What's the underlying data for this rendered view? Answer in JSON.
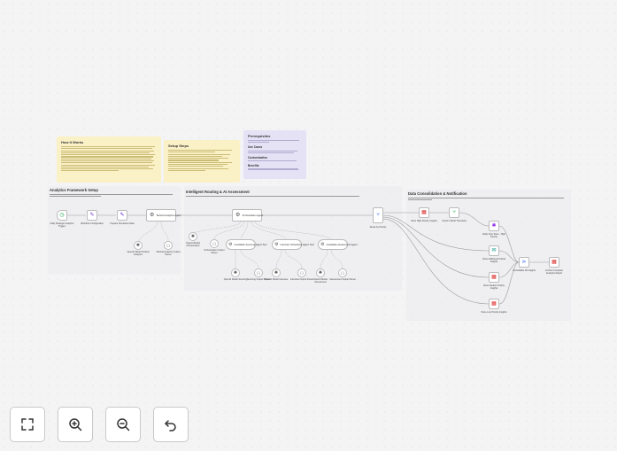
{
  "notes": {
    "how_it_works": {
      "title": "How It Works"
    },
    "setup_steps": {
      "title": "Setup Steps"
    },
    "prereq": {
      "title": "Prerequisites",
      "use_cases": "Use Cases",
      "customization": "Customization",
      "benefits": "Benefits"
    }
  },
  "sections": {
    "setup": {
      "title": "Analytics Framework Setup"
    },
    "routing": {
      "title": "Intelligent Routing & AI Assessment"
    },
    "consolidation": {
      "title": "Data Consolidation & Notification"
    }
  },
  "nodes": {
    "trigger": "Daily Strategic Analytics Trigger",
    "workflow_config": "Workflow Configuration",
    "prepare": "Prepare Simulation Data",
    "agent1": "Tactical Analytics Agent",
    "orchestration": "Orchestration Agent",
    "route": "Route by Priority",
    "high_priority": "Store High Priority Insights",
    "critical": "Check Critical Threshold",
    "slack": "Notify Ops Team - High Priority",
    "critical_insights": "Store Additional Critical Insights",
    "medium": "Store Medium Priority Insights",
    "low": "Store Low Priority Insights",
    "consolidate": "Consolidate All Insights",
    "archive": "Archive Complete Analytics Report",
    "openai_main": "OpenAI Model Tactical Analytics",
    "parser_main": "Tactical Analytics Output Parser",
    "tool1": "Candidate Sourcing Agent Tool",
    "tool2": "Interview Scheduling Agent Tool",
    "tool3": "Candidate Assessment Agent",
    "openai_orch": "OpenAI Model Orchestration",
    "parser_orch": "Orchestration Output Parser",
    "openai_t1": "OpenAI Model Sourcing",
    "parser_t1": "Sourcing Output Parser",
    "openai_t2": "OpenAI Model Interview",
    "parser_t2": "Interview Output Parser",
    "openai_t3": "OpenAI Model Assessment",
    "parser_t3": "Assessment Output Parser"
  },
  "controls": {
    "fit": "fit-view",
    "zoom_in": "zoom-in",
    "zoom_out": "zoom-out",
    "undo": "undo"
  },
  "colors": {
    "note_yellow": "#fbf1c7",
    "note_purple": "#e6e2f6",
    "canvas": "#f4f4f5"
  }
}
